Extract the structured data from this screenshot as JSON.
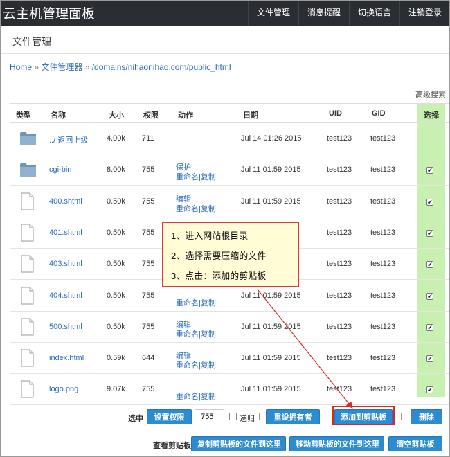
{
  "topbar": {
    "brand": "云主机管理面板",
    "nav": [
      "文件管理",
      "消息提醒",
      "切换语言",
      "注销登录"
    ]
  },
  "page_title": "文件管理",
  "breadcrumb": {
    "home": "Home",
    "sep1": " » ",
    "file_manager": "文件管理器",
    "sep2": " » ",
    "path": "/domains/nihaonihao.com/public_html"
  },
  "advanced_search": "高级搜索",
  "columns": [
    "类型",
    "名称",
    "大小",
    "权限",
    "动作",
    "日期",
    "UID",
    "GID",
    "选择"
  ],
  "rows": [
    {
      "type": "folder",
      "name": "../ 返回上级",
      "size": "4.00k",
      "perm": "711",
      "act1": "",
      "act2a": "",
      "act2b": "",
      "date": "Jul 14 01:26 2015",
      "uid": "test123",
      "gid": "test123",
      "checked": false
    },
    {
      "type": "folder",
      "name": "cgi-bin",
      "size": "8.00k",
      "perm": "755",
      "act1": "保护",
      "act2a": "重命名",
      "act2b": "复制",
      "date": "Jul 11 01:59 2015",
      "uid": "test123",
      "gid": "test123",
      "checked": true
    },
    {
      "type": "file",
      "name": "400.shtml",
      "size": "0.50k",
      "perm": "755",
      "act1": "编辑",
      "act2a": "重命名",
      "act2b": "复制",
      "date": "Jul 11 01:59 2015",
      "uid": "test123",
      "gid": "test123",
      "checked": true
    },
    {
      "type": "file",
      "name": "401.shtml",
      "size": "0.50k",
      "perm": "755",
      "act1": "",
      "act2a": "",
      "act2b": "",
      "date": "",
      "uid": "test123",
      "gid": "test123",
      "checked": true
    },
    {
      "type": "file",
      "name": "403.shtml",
      "size": "0.50k",
      "perm": "755",
      "act1": "",
      "act2a": "",
      "act2b": "",
      "date": "",
      "uid": "test123",
      "gid": "test123",
      "checked": true
    },
    {
      "type": "file",
      "name": "404.shtml",
      "size": "0.50k",
      "perm": "755",
      "act1": "",
      "act2a": "重命名",
      "act2b": "复制",
      "date": "Jul 11 01:59 2015",
      "uid": "test123",
      "gid": "test123",
      "checked": true
    },
    {
      "type": "file",
      "name": "500.shtml",
      "size": "0.50k",
      "perm": "755",
      "act1": "编辑",
      "act2a": "重命名",
      "act2b": "复制",
      "date": "Jul 11 01:59 2015",
      "uid": "test123",
      "gid": "test123",
      "checked": true
    },
    {
      "type": "file",
      "name": "index.html",
      "size": "0.59k",
      "perm": "644",
      "act1": "编辑",
      "act2a": "重命名",
      "act2b": "复制",
      "date": "Jul 11 01:59 2015",
      "uid": "test123",
      "gid": "test123",
      "checked": true
    },
    {
      "type": "file",
      "name": "logo.png",
      "size": "9.07k",
      "perm": "755",
      "act1": "",
      "act2a": "重命名",
      "act2b": "复制",
      "date": "Jul 11 01:59 2015",
      "uid": "test123",
      "gid": "test123",
      "checked": true
    }
  ],
  "act_sep": "|",
  "check_mark": "✔",
  "actions": {
    "selected_label": "选中",
    "set_perm": "设置权限",
    "perm_value": "755",
    "recursive": "递归",
    "sep": "|",
    "set_owner": "重设拥有者",
    "add_clipboard": "添加到剪贴板",
    "delete": "删除",
    "view_clipboard": "查看剪贴板",
    "copy_here": "复制剪贴板的文件到这里",
    "move_here": "移动剪贴板的文件到这里",
    "clear_clipboard": "清空剪贴板"
  },
  "callout": {
    "step1": "1、进入网站根目录",
    "step2": "2、选择需要压缩的文件",
    "step3": "3、点击：添加的剪贴板"
  },
  "colors": {
    "topbar": "#2a2e33",
    "link": "#2a6ebd",
    "button": "#2d8ccf",
    "select_column": "#c8f0b0",
    "annotation": "#d42a2a"
  }
}
